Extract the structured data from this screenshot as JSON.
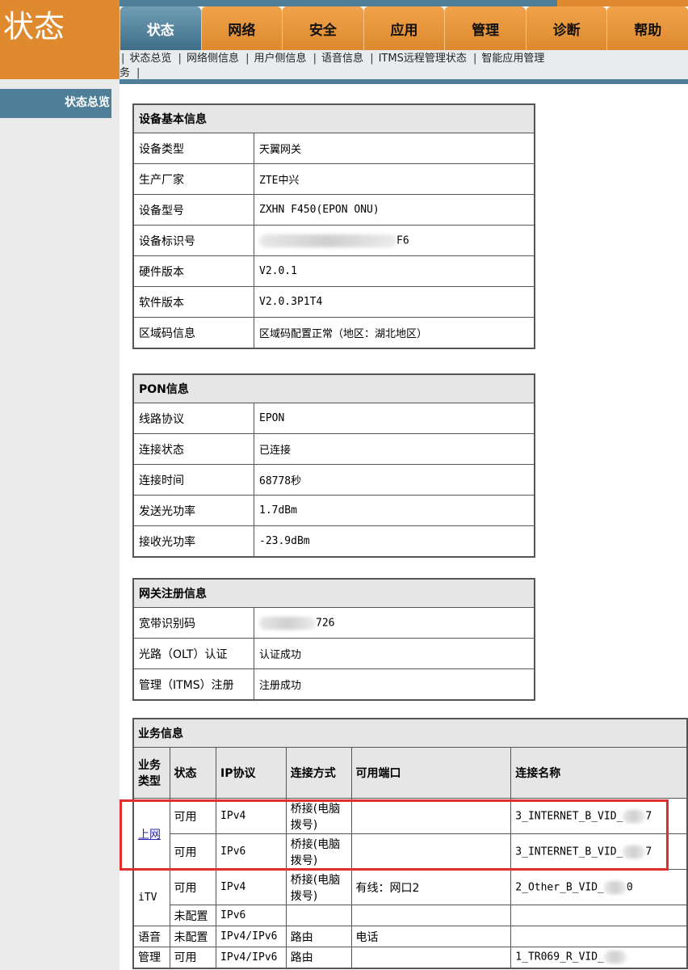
{
  "brand": {
    "title": "状态"
  },
  "tabs": [
    {
      "label": "状态",
      "active": true
    },
    {
      "label": "网络"
    },
    {
      "label": "安全"
    },
    {
      "label": "应用"
    },
    {
      "label": "管理"
    },
    {
      "label": "诊断"
    },
    {
      "label": "帮助"
    }
  ],
  "subnav": {
    "items": [
      "状态总览",
      "网络侧信息",
      "用户侧信息",
      "语音信息",
      "ITMS远程管理状态",
      "智能应用管理",
      "务"
    ]
  },
  "sidebar": {
    "item_label": "状态总览"
  },
  "device": {
    "header": "设备基本信息",
    "rows": [
      {
        "label": "设备类型",
        "value": "天翼网关"
      },
      {
        "label": "生产厂家",
        "value": "ZTE中兴"
      },
      {
        "label": "设备型号",
        "value": "ZXHN  F450(EPON  ONU)"
      },
      {
        "label": "设备标识号",
        "value": "F6"
      },
      {
        "label": "硬件版本",
        "value": "V2.0.1"
      },
      {
        "label": "软件版本",
        "value": "V2.0.3P1T4"
      },
      {
        "label": "区域码信息",
        "value": "区域码配置正常（地区：湖北地区）"
      }
    ]
  },
  "pon": {
    "header": "PON信息",
    "rows": [
      {
        "label": "线路协议",
        "value": "EPON"
      },
      {
        "label": "连接状态",
        "value": "已连接"
      },
      {
        "label": "连接时间",
        "value": "68778秒"
      },
      {
        "label": "发送光功率",
        "value": "1.7dBm"
      },
      {
        "label": "接收光功率",
        "value": "-23.9dBm"
      }
    ]
  },
  "gateway": {
    "header": "网关注册信息",
    "rows": [
      {
        "label": "宽带识别码",
        "value": "726"
      },
      {
        "label": "光路（OLT）认证",
        "value": "认证成功"
      },
      {
        "label": "管理（ITMS）注册",
        "value": "注册成功"
      }
    ]
  },
  "service": {
    "header": "业务信息",
    "columns": [
      "业务类型",
      "状态",
      "IP协议",
      "连接方式",
      "可用端口",
      "连接名称"
    ],
    "rows": [
      {
        "type": "上网",
        "status": "可用",
        "ip": "IPv4",
        "mode": "桥接(电脑拨号)",
        "port": "",
        "name": "3_INTERNET_B_VID_",
        "name_tail": "7"
      },
      {
        "type": "",
        "status": "可用",
        "ip": "IPv6",
        "mode": "桥接(电脑拨号)",
        "port": "",
        "name": "3_INTERNET_B_VID_",
        "name_tail": "7"
      },
      {
        "type": "iTV",
        "status": "可用",
        "ip": "IPv4",
        "mode": "桥接(电脑拨号)",
        "port": "有线：网口2",
        "name": "2_Other_B_VID_",
        "name_tail": "0"
      },
      {
        "type": "",
        "status": "未配置",
        "ip": "IPv6",
        "mode": "",
        "port": "",
        "name": "",
        "name_tail": ""
      },
      {
        "type": "语音",
        "status": "未配置",
        "ip": "IPv4/IPv6",
        "mode": "路由",
        "port": "电话",
        "name": "",
        "name_tail": ""
      },
      {
        "type": "管理",
        "status": "可用",
        "ip": "IPv4/IPv6",
        "mode": "路由",
        "port": "",
        "name": "1_TR069_R_VID_",
        "name_tail": ""
      }
    ]
  },
  "colors": {
    "accent_orange": "#e08a30",
    "accent_blue": "#4f7f98",
    "highlight": "#e0302e"
  }
}
